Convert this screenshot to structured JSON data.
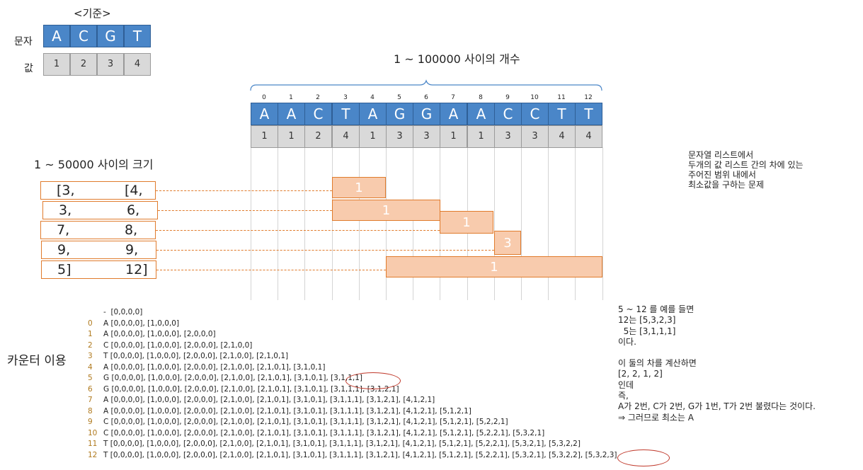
{
  "legend": {
    "title": "<기준>",
    "row1_label": "문자",
    "row2_label": "값",
    "letters": [
      "A",
      "C",
      "G",
      "T"
    ],
    "values": [
      "1",
      "2",
      "3",
      "4"
    ]
  },
  "sequence": {
    "title": "1 ~ 100000 사이의 개수",
    "indices": [
      "0",
      "1",
      "2",
      "3",
      "4",
      "5",
      "6",
      "7",
      "8",
      "9",
      "10",
      "11",
      "12"
    ],
    "letters": [
      "A",
      "A",
      "C",
      "T",
      "A",
      "G",
      "G",
      "A",
      "A",
      "C",
      "C",
      "T",
      "T"
    ],
    "values": [
      "1",
      "1",
      "2",
      "4",
      "1",
      "3",
      "3",
      "1",
      "1",
      "3",
      "3",
      "4",
      "4"
    ]
  },
  "queries": {
    "title": "1 ~ 50000 사이의 크기",
    "rows": [
      {
        "left": "[3,",
        "right": "[4,",
        "result": "1"
      },
      {
        "left": "3,",
        "right": "6,",
        "result": "1"
      },
      {
        "left": "7,",
        "right": "8,",
        "result": "1"
      },
      {
        "left": "9,",
        "right": "9,",
        "result": "3"
      },
      {
        "left": "5]",
        "right": "12]",
        "result": "1"
      }
    ]
  },
  "problem_note": [
    "문자열 리스트에서",
    "두개의 값 리스트 간의 차에 있는",
    "주어진 범위 내에서",
    "최소값을 구하는 문제"
  ],
  "counter": {
    "label": "카운터 이용",
    "lines": [
      {
        "n": "",
        "text": "-  [0,0,0,0]"
      },
      {
        "n": "0",
        "text": "A [0,0,0,0], [1,0,0,0]"
      },
      {
        "n": "1",
        "text": "A [0,0,0,0], [1,0,0,0], [2,0,0,0]"
      },
      {
        "n": "2",
        "text": "C [0,0,0,0], [1,0,0,0], [2,0,0,0], [2,1,0,0]"
      },
      {
        "n": "3",
        "text": "T [0,0,0,0], [1,0,0,0], [2,0,0,0], [2,1,0,0], [2,1,0,1]"
      },
      {
        "n": "4",
        "text": "A [0,0,0,0], [1,0,0,0], [2,0,0,0], [2,1,0,0], [2,1,0,1], [3,1,0,1]"
      },
      {
        "n": "5",
        "text": "G [0,0,0,0], [1,0,0,0], [2,0,0,0], [2,1,0,0], [2,1,0,1], [3,1,0,1], [3,1,1,1]"
      },
      {
        "n": "6",
        "text": "G [0,0,0,0], [1,0,0,0], [2,0,0,0], [2,1,0,0], [2,1,0,1], [3,1,0,1], [3,1,1,1], [3,1,2,1]"
      },
      {
        "n": "7",
        "text": "A [0,0,0,0], [1,0,0,0], [2,0,0,0], [2,1,0,0], [2,1,0,1], [3,1,0,1], [3,1,1,1], [3,1,2,1], [4,1,2,1]"
      },
      {
        "n": "8",
        "text": "A [0,0,0,0], [1,0,0,0], [2,0,0,0], [2,1,0,0], [2,1,0,1], [3,1,0,1], [3,1,1,1], [3,1,2,1], [4,1,2,1], [5,1,2,1]"
      },
      {
        "n": "9",
        "text": "C [0,0,0,0], [1,0,0,0], [2,0,0,0], [2,1,0,0], [2,1,0,1], [3,1,0,1], [3,1,1,1], [3,1,2,1], [4,1,2,1], [5,1,2,1], [5,2,2,1]"
      },
      {
        "n": "10",
        "text": "C [0,0,0,0], [1,0,0,0], [2,0,0,0], [2,1,0,0], [2,1,0,1], [3,1,0,1], [3,1,1,1], [3,1,2,1], [4,1,2,1], [5,1,2,1], [5,2,2,1], [5,3,2,1]"
      },
      {
        "n": "11",
        "text": "T [0,0,0,0], [1,0,0,0], [2,0,0,0], [2,1,0,0], [2,1,0,1], [3,1,0,1], [3,1,1,1], [3,1,2,1], [4,1,2,1], [5,1,2,1], [5,2,2,1], [5,3,2,1], [5,3,2,2]"
      },
      {
        "n": "12",
        "text": "T [0,0,0,0], [1,0,0,0], [2,0,0,0], [2,1,0,0], [2,1,0,1], [3,1,0,1], [3,1,1,1], [3,1,2,1], [4,1,2,1], [5,1,2,1], [5,2,2,1], [5,3,2,1], [5,3,2,2], [5,3,2,3]"
      }
    ]
  },
  "example_note": [
    "5 ~ 12 를 예를 들면",
    "12는 [5,3,2,3]",
    "  5는 [3,1,1,1]",
    "이다.",
    "",
    "이 둘의 차를 계산하면",
    "[2, 2, 1, 2]",
    "인데",
    "즉,",
    "A가 2번, C가 2번, G가 1번, T가 2번 불렸다는 것이다.",
    "⇒ 그러므로 최소는 A"
  ]
}
